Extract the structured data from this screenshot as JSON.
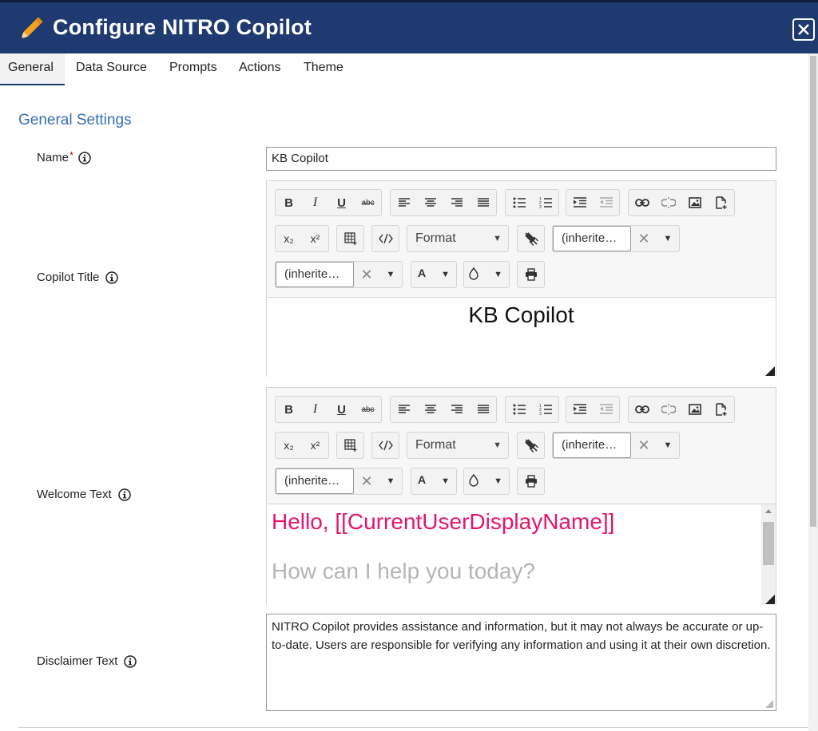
{
  "header": {
    "title": "Configure NITRO Copilot",
    "icon": "pencil-icon",
    "close_icon": "close-icon",
    "bg_color": "#1e3a70"
  },
  "tabs": [
    {
      "label": "General",
      "active": true
    },
    {
      "label": "Data Source"
    },
    {
      "label": "Prompts"
    },
    {
      "label": "Actions"
    },
    {
      "label": "Theme"
    }
  ],
  "section_title": "General Settings",
  "fields": {
    "name": {
      "label": "Name",
      "required_mark": "*",
      "value": "KB Copilot"
    },
    "copilot_title": {
      "label": "Copilot Title",
      "content": "KB Copilot"
    },
    "welcome_text": {
      "label": "Welcome Text",
      "line1": "Hello, [[CurrentUserDisplayName]]",
      "line2": "How can I help you today?",
      "line1_color": "#e5146f"
    },
    "disclaimer_text": {
      "label": "Disclaimer Text",
      "value": "NITRO Copilot provides assistance and information, but it may not always be accurate or up-to-date. Users are responsible for verifying any information and using it at their own discretion."
    }
  },
  "toolbar": {
    "bold": "B",
    "italic": "I",
    "underline": "U",
    "strike": "abc",
    "subscript": "x₂",
    "superscript": "x²",
    "format": "Format",
    "font_family": "(inherite…",
    "font_size": "(inherite…",
    "clear": "✕",
    "text_color": "A",
    "accent_color": "#3a6fb4"
  }
}
